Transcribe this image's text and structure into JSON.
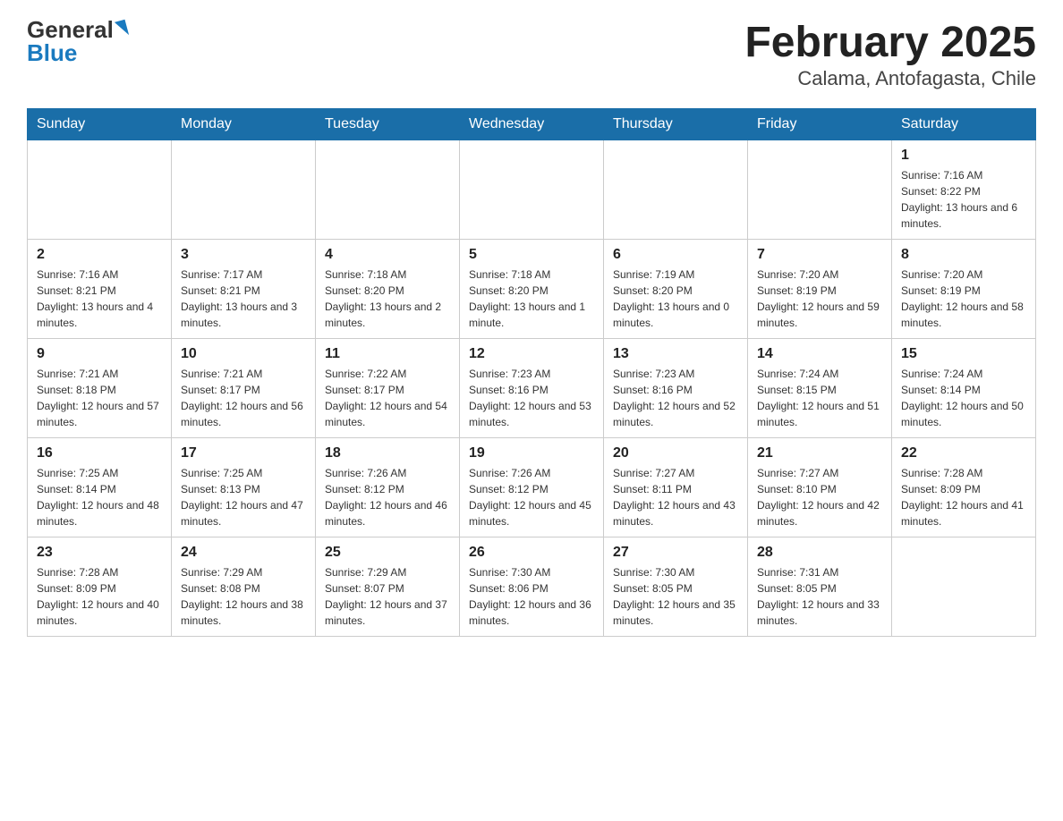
{
  "logo": {
    "general": "General",
    "blue": "Blue"
  },
  "title": "February 2025",
  "subtitle": "Calama, Antofagasta, Chile",
  "days_of_week": [
    "Sunday",
    "Monday",
    "Tuesday",
    "Wednesday",
    "Thursday",
    "Friday",
    "Saturday"
  ],
  "weeks": [
    [
      {
        "day": "",
        "info": ""
      },
      {
        "day": "",
        "info": ""
      },
      {
        "day": "",
        "info": ""
      },
      {
        "day": "",
        "info": ""
      },
      {
        "day": "",
        "info": ""
      },
      {
        "day": "",
        "info": ""
      },
      {
        "day": "1",
        "info": "Sunrise: 7:16 AM\nSunset: 8:22 PM\nDaylight: 13 hours and 6 minutes."
      }
    ],
    [
      {
        "day": "2",
        "info": "Sunrise: 7:16 AM\nSunset: 8:21 PM\nDaylight: 13 hours and 4 minutes."
      },
      {
        "day": "3",
        "info": "Sunrise: 7:17 AM\nSunset: 8:21 PM\nDaylight: 13 hours and 3 minutes."
      },
      {
        "day": "4",
        "info": "Sunrise: 7:18 AM\nSunset: 8:20 PM\nDaylight: 13 hours and 2 minutes."
      },
      {
        "day": "5",
        "info": "Sunrise: 7:18 AM\nSunset: 8:20 PM\nDaylight: 13 hours and 1 minute."
      },
      {
        "day": "6",
        "info": "Sunrise: 7:19 AM\nSunset: 8:20 PM\nDaylight: 13 hours and 0 minutes."
      },
      {
        "day": "7",
        "info": "Sunrise: 7:20 AM\nSunset: 8:19 PM\nDaylight: 12 hours and 59 minutes."
      },
      {
        "day": "8",
        "info": "Sunrise: 7:20 AM\nSunset: 8:19 PM\nDaylight: 12 hours and 58 minutes."
      }
    ],
    [
      {
        "day": "9",
        "info": "Sunrise: 7:21 AM\nSunset: 8:18 PM\nDaylight: 12 hours and 57 minutes."
      },
      {
        "day": "10",
        "info": "Sunrise: 7:21 AM\nSunset: 8:17 PM\nDaylight: 12 hours and 56 minutes."
      },
      {
        "day": "11",
        "info": "Sunrise: 7:22 AM\nSunset: 8:17 PM\nDaylight: 12 hours and 54 minutes."
      },
      {
        "day": "12",
        "info": "Sunrise: 7:23 AM\nSunset: 8:16 PM\nDaylight: 12 hours and 53 minutes."
      },
      {
        "day": "13",
        "info": "Sunrise: 7:23 AM\nSunset: 8:16 PM\nDaylight: 12 hours and 52 minutes."
      },
      {
        "day": "14",
        "info": "Sunrise: 7:24 AM\nSunset: 8:15 PM\nDaylight: 12 hours and 51 minutes."
      },
      {
        "day": "15",
        "info": "Sunrise: 7:24 AM\nSunset: 8:14 PM\nDaylight: 12 hours and 50 minutes."
      }
    ],
    [
      {
        "day": "16",
        "info": "Sunrise: 7:25 AM\nSunset: 8:14 PM\nDaylight: 12 hours and 48 minutes."
      },
      {
        "day": "17",
        "info": "Sunrise: 7:25 AM\nSunset: 8:13 PM\nDaylight: 12 hours and 47 minutes."
      },
      {
        "day": "18",
        "info": "Sunrise: 7:26 AM\nSunset: 8:12 PM\nDaylight: 12 hours and 46 minutes."
      },
      {
        "day": "19",
        "info": "Sunrise: 7:26 AM\nSunset: 8:12 PM\nDaylight: 12 hours and 45 minutes."
      },
      {
        "day": "20",
        "info": "Sunrise: 7:27 AM\nSunset: 8:11 PM\nDaylight: 12 hours and 43 minutes."
      },
      {
        "day": "21",
        "info": "Sunrise: 7:27 AM\nSunset: 8:10 PM\nDaylight: 12 hours and 42 minutes."
      },
      {
        "day": "22",
        "info": "Sunrise: 7:28 AM\nSunset: 8:09 PM\nDaylight: 12 hours and 41 minutes."
      }
    ],
    [
      {
        "day": "23",
        "info": "Sunrise: 7:28 AM\nSunset: 8:09 PM\nDaylight: 12 hours and 40 minutes."
      },
      {
        "day": "24",
        "info": "Sunrise: 7:29 AM\nSunset: 8:08 PM\nDaylight: 12 hours and 38 minutes."
      },
      {
        "day": "25",
        "info": "Sunrise: 7:29 AM\nSunset: 8:07 PM\nDaylight: 12 hours and 37 minutes."
      },
      {
        "day": "26",
        "info": "Sunrise: 7:30 AM\nSunset: 8:06 PM\nDaylight: 12 hours and 36 minutes."
      },
      {
        "day": "27",
        "info": "Sunrise: 7:30 AM\nSunset: 8:05 PM\nDaylight: 12 hours and 35 minutes."
      },
      {
        "day": "28",
        "info": "Sunrise: 7:31 AM\nSunset: 8:05 PM\nDaylight: 12 hours and 33 minutes."
      },
      {
        "day": "",
        "info": ""
      }
    ]
  ]
}
